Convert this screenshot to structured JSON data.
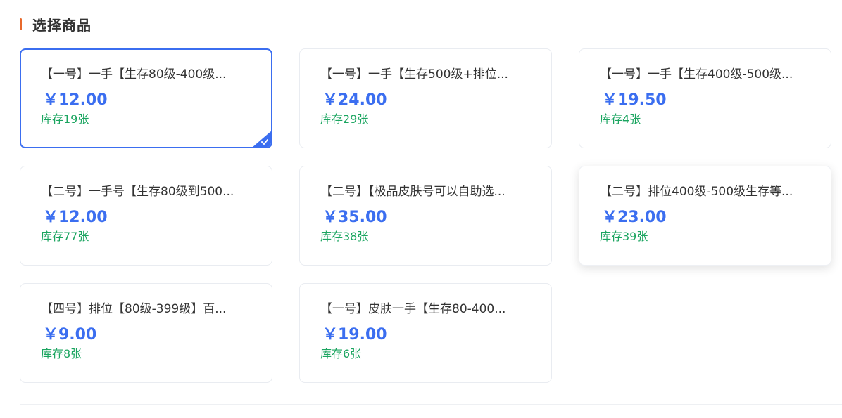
{
  "section": {
    "title": "选择商品",
    "accent_color": "#e8692c"
  },
  "colors": {
    "price": "#3b6ef0",
    "stock": "#1ba560",
    "selected_border": "#3b6ef0"
  },
  "products": [
    {
      "name": "【一号】一手【生存80级-400级...",
      "price": "￥12.00",
      "stock": "库存19张",
      "selected": true
    },
    {
      "name": "【一号】一手【生存500级+排位...",
      "price": "￥24.00",
      "stock": "库存29张"
    },
    {
      "name": "【一号】一手【生存400级-500级...",
      "price": "￥19.50",
      "stock": "库存4张"
    },
    {
      "name": "【二号】一手号【生存80级到500...",
      "price": "￥12.00",
      "stock": "库存77张"
    },
    {
      "name": "【二号】【极品皮肤号可以自助选...",
      "price": "￥35.00",
      "stock": "库存38张"
    },
    {
      "name": "【二号】排位400级-500级生存等...",
      "price": "￥23.00",
      "stock": "库存39张",
      "hovered": true
    },
    {
      "name": "【四号】排位【80级-399级】百...",
      "price": "￥9.00",
      "stock": "库存8张"
    },
    {
      "name": "【一号】皮肤一手【生存80-400...",
      "price": "￥19.00",
      "stock": "库存6张"
    }
  ]
}
